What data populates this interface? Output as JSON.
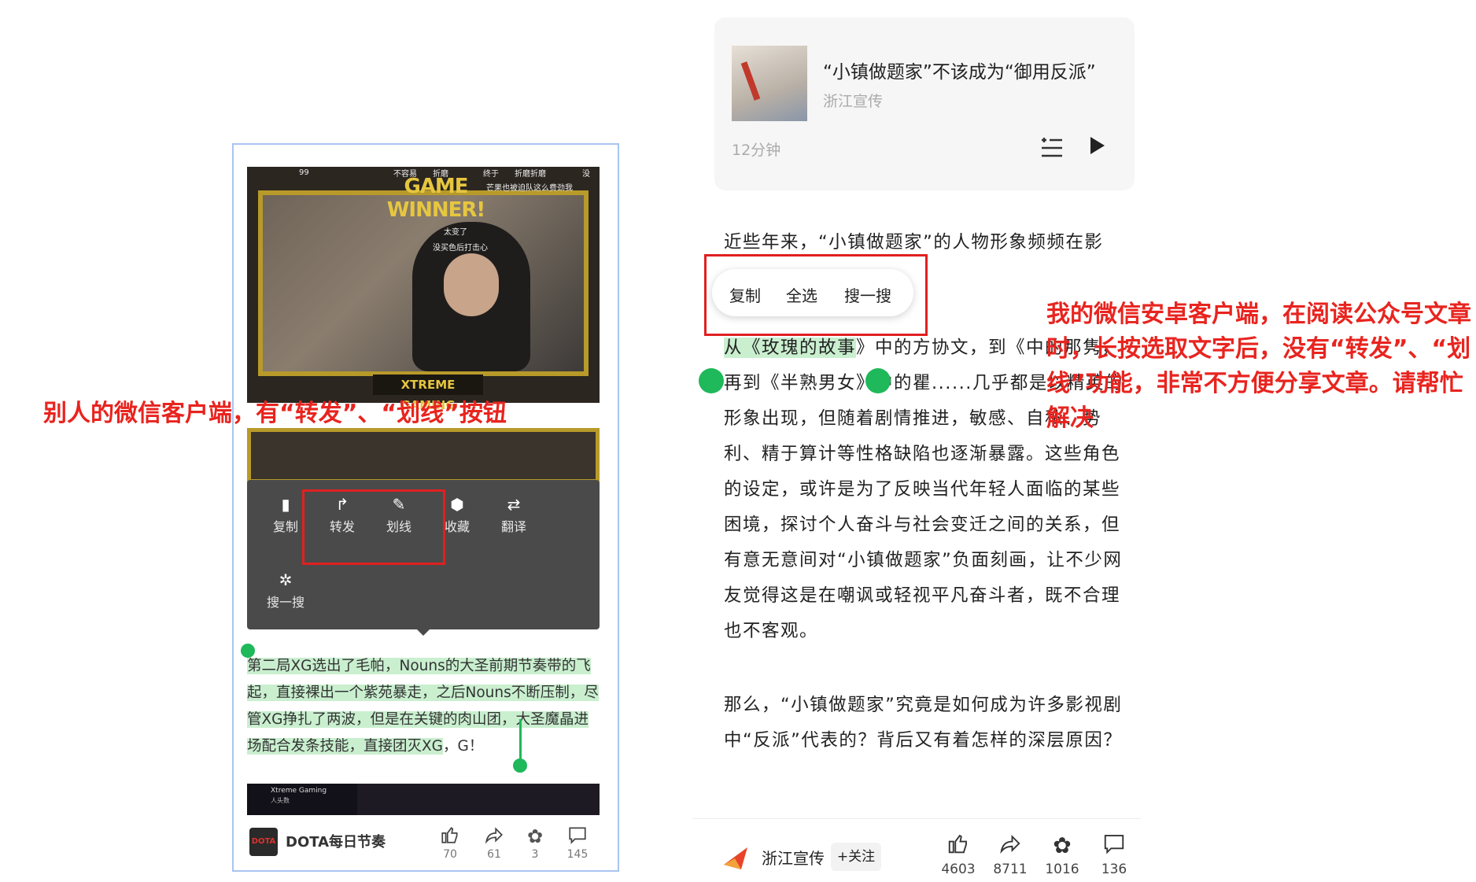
{
  "left_phone": {
    "video_overlay": {
      "game_winner": "GAME WINNER!",
      "team_name": "XTREME GAMING",
      "danmaku": [
        "99",
        "不容易",
        "折磨",
        "终于",
        "折磨折磨",
        "没",
        "芒果也被迫队这么费劲我",
        "太变了",
        "没买色后打击心"
      ]
    },
    "context_menu": {
      "row1": [
        {
          "icon": "document-icon",
          "glyph": "▮",
          "label": "复制"
        },
        {
          "icon": "forward-icon",
          "glyph": "↱",
          "label": "转发"
        },
        {
          "icon": "underline-pen-icon",
          "glyph": "✎",
          "label": "划线"
        },
        {
          "icon": "cube-icon",
          "glyph": "⬢",
          "label": "收藏"
        },
        {
          "icon": "translate-icon",
          "glyph": "⇄",
          "label": "翻译"
        }
      ],
      "row2": [
        {
          "icon": "search-star-icon",
          "glyph": "✲",
          "label": "搜一搜"
        }
      ]
    },
    "selected_text": {
      "highlighted": "第二局XG选出了毛帕，Nouns的大圣前期节奏带的飞起，直接裸出一个紫苑暴走，之后Nouns不断压制，尽管XG挣扎了两波，但是在关键的肉山团，大圣魔晶进场配合发条技能，直接团灭XG",
      "rest": "，G！"
    },
    "video3_overlay": {
      "label": "Xtreme Gaming",
      "sub": "人头数"
    },
    "bottom_bar": {
      "account_name": "DOTA每日节奏",
      "avatar_text": "DOTA",
      "actions": [
        {
          "icon": "thumbs-up-icon",
          "glyph": "👍",
          "count": "70"
        },
        {
          "icon": "share-icon",
          "glyph": "↱",
          "count": "61"
        },
        {
          "icon": "flower-icon",
          "glyph": "✿",
          "count": "3"
        },
        {
          "icon": "comment-icon",
          "glyph": "▭",
          "count": "145"
        }
      ]
    }
  },
  "captions": {
    "left": "别人的微信客户端，有“转发”、“划线”按钮",
    "right": "我的微信安卓客户端，在阅读公众号文章时，长按选取文字后，没有“转发”、“划线”功能，非常不方便分享文章。请帮忙解决"
  },
  "right_article": {
    "audio_card": {
      "title": "“小镇做题家”不该成为“御用反派”",
      "source": "浙江宣传",
      "duration": "12分钟",
      "list_icon": "playlist-icon",
      "play_icon": "play-icon"
    },
    "paragraph1_line1": "近些年来，“小镇做题家”的人物形象频频在影",
    "paragraph1_selected": "从《玫瑰的故事",
    "paragraph1_after_selected": "》中的方协文，到《",
    "paragraph1_rest": "中的那隽，再到《半熟男女》中的瞿......几乎都是以精英的形象出现，但随着剧情推进，敏感、自私、势利、精于算计等性格缺陷也逐渐暴露。这些角色的设定，或许是为了反映当代年轻人面临的某些困境，探讨个人奋斗与社会变迁之间的关系，但有意无意间对“小镇做题家”负面刻画，让不少网友觉得这是在嘲讽或轻视平凡奋斗者，既不合理也不客观。",
    "paragraph2": "那么，“小镇做题家”究竟是如何成为许多影视剧中“反派”代表的？背后又有着怎样的深层原因？",
    "copy_bar": {
      "copy": "复制",
      "select_all": "全选",
      "search": "搜一搜"
    },
    "bottom_bar": {
      "account_name": "浙江宣传",
      "follow": "+关注",
      "actions": [
        {
          "icon": "thumbs-up-icon",
          "glyph": "👍",
          "count": "4603"
        },
        {
          "icon": "share-icon",
          "glyph": "↱",
          "count": "8711"
        },
        {
          "icon": "flower-icon",
          "glyph": "✿",
          "count": "1016"
        },
        {
          "icon": "comment-icon",
          "glyph": "▭",
          "count": "136"
        }
      ]
    }
  },
  "colors": {
    "highlight_green": "#c9efcf",
    "handle_green": "#1fb85a",
    "annotation_red": "#e8241f"
  }
}
